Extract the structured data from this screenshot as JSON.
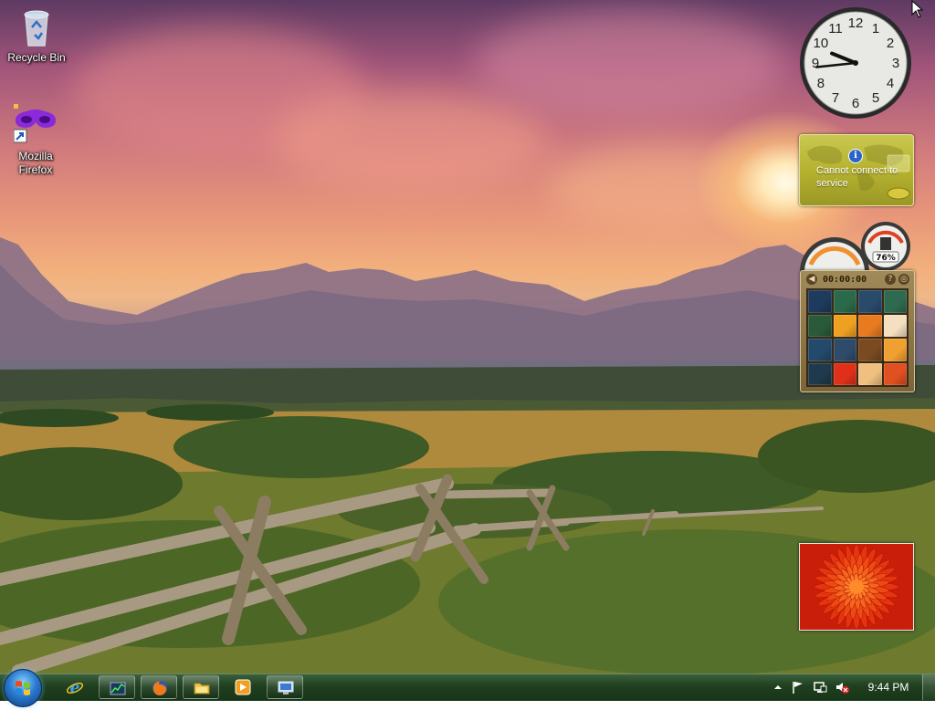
{
  "desktop": {
    "icons": [
      {
        "label": "Recycle Bin",
        "icon": "recycle-bin-icon"
      },
      {
        "label": "Mozilla Firefox",
        "icon": "firefox-shortcut-icon"
      }
    ]
  },
  "gadgets": {
    "clock": {
      "hour": 9,
      "minute": 44
    },
    "weather": {
      "message": "Cannot connect to service",
      "icon": "info-icon"
    },
    "cpu_meter": {
      "memory_percent_label": "76%"
    },
    "picture_puzzle": {
      "timer": "00:00:00",
      "tile_colors": [
        "#1e3a5c",
        "#2a6a4a",
        "#2a4a6a",
        "#2e6a50",
        "#2a5a3a",
        "#f0a020",
        "#e87a20",
        "#f4e0c0",
        "#234a6a",
        "#2e4c6a",
        "#7a4a20",
        "#f0a030",
        "#1e3a4c",
        "#e0301a",
        "#f0c080",
        "#e05020"
      ]
    },
    "slideshow": {
      "subject": "red chrysanthemum"
    }
  },
  "taskbar": {
    "start": {
      "icon": "windows-logo-icon"
    },
    "pinned": [
      {
        "name": "internet-explorer",
        "icon": "ie-icon"
      },
      {
        "name": "performance-monitor",
        "icon": "chart-icon"
      },
      {
        "name": "firefox",
        "icon": "firefox-icon"
      },
      {
        "name": "windows-explorer",
        "icon": "folder-icon"
      },
      {
        "name": "media-player",
        "icon": "play-icon"
      },
      {
        "name": "remote-desktop",
        "icon": "monitor-icon"
      }
    ],
    "tray": {
      "icons": [
        "chevron-up-icon",
        "flag-icon",
        "network-icon",
        "volume-muted-icon"
      ],
      "time": "9:44 PM"
    }
  },
  "colors": {
    "taskbar": "#1f3f1f",
    "weather_gadget": "#b3b02e",
    "sky_top": "#5e3a63",
    "sky_horizon": "#f0b888"
  }
}
